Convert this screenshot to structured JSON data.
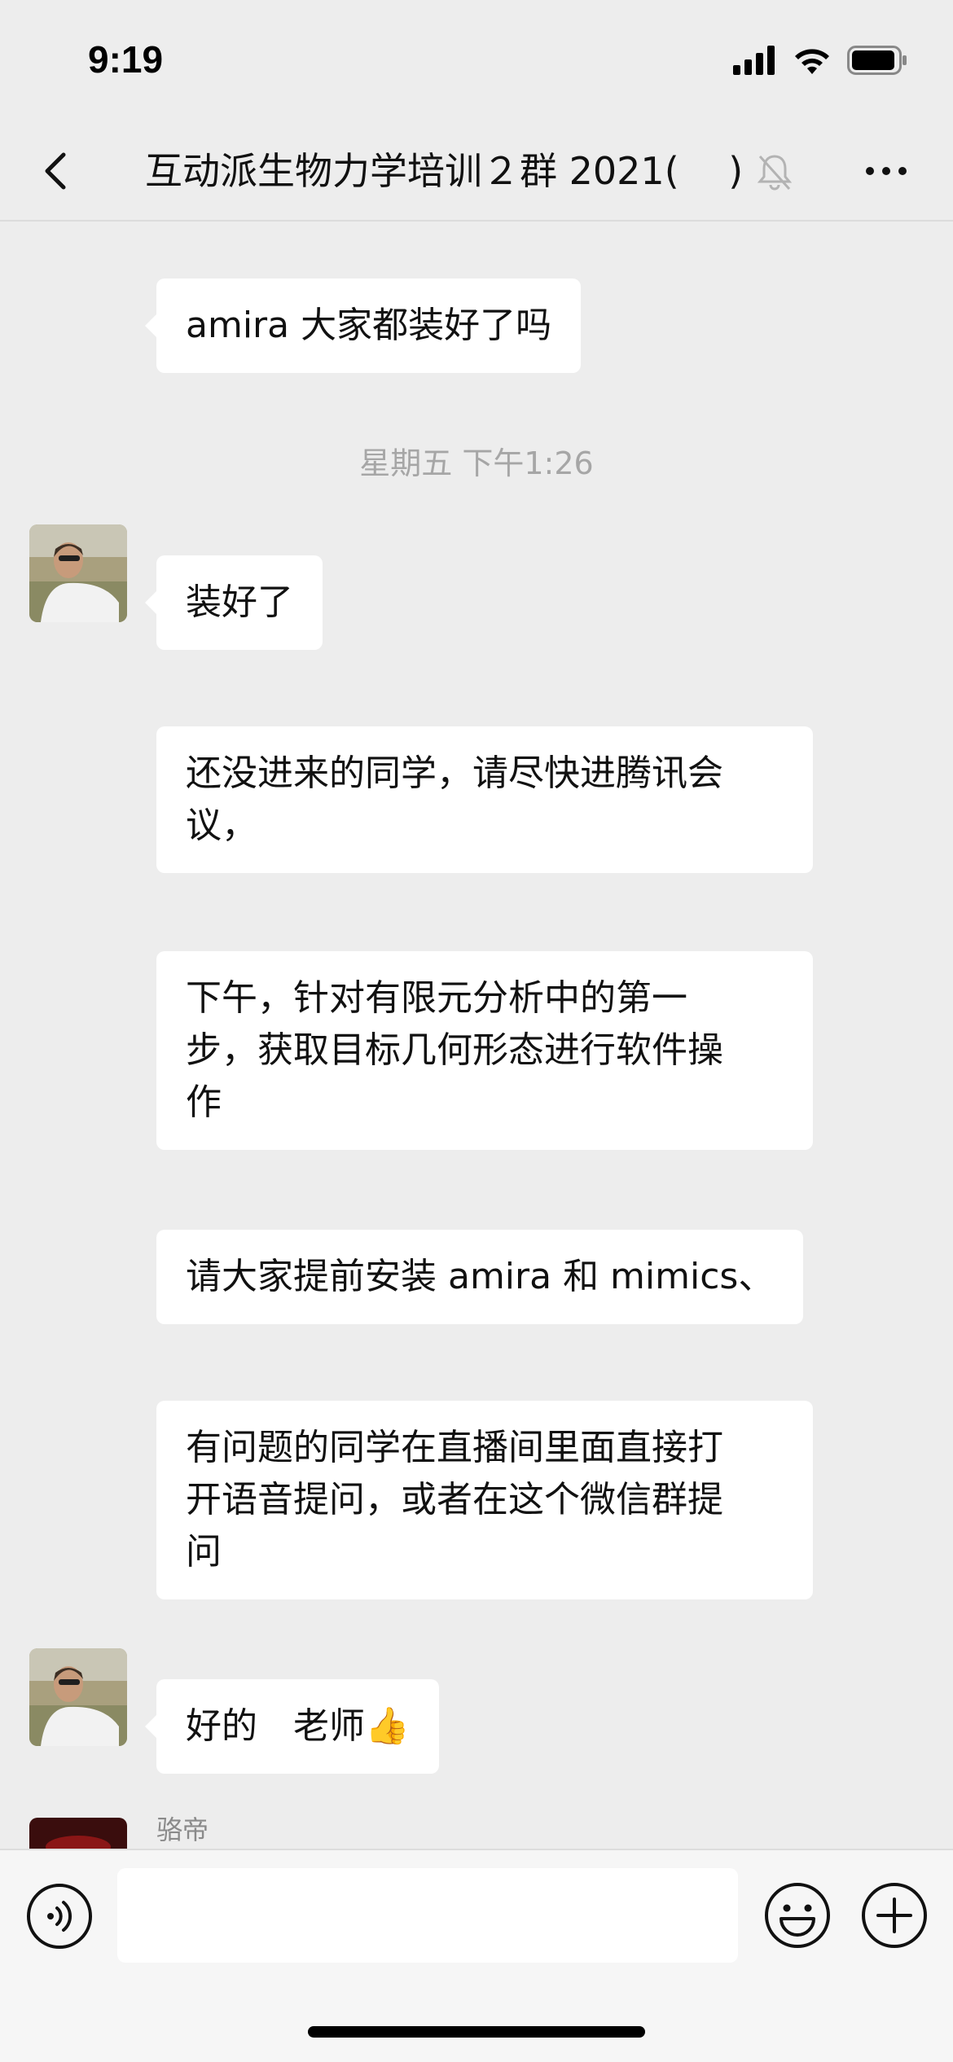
{
  "status_bar": {
    "time": "9:19"
  },
  "nav": {
    "title": "互动派生物力学培训２群 2021(　 )",
    "back_icon": "chevron-left-icon",
    "mute_icon": "bell-slash-icon",
    "more_icon": "more-dots-icon"
  },
  "messages": [
    {
      "type": "text",
      "text": "amira 大家都装好了吗"
    },
    {
      "type": "timestamp",
      "text": "星期五 下午1:26"
    },
    {
      "type": "text",
      "text": "装好了"
    },
    {
      "type": "text",
      "lines": [
        "还没进来的同学，请尽快进腾讯会",
        "议，"
      ]
    },
    {
      "type": "text",
      "lines": [
        "下午，针对有限元分析中的第一",
        "步，获取目标几何形态进行软件操",
        "作"
      ]
    },
    {
      "type": "text",
      "text": "请大家提前安装 amira 和 mimics、"
    },
    {
      "type": "text",
      "lines": [
        "有问题的同学在直播间里面直接打",
        "开语音提问，或者在这个微信群提",
        "问"
      ]
    },
    {
      "type": "text",
      "text": "好的　老师",
      "emoji": "👍"
    },
    {
      "type": "sender",
      "text": "骆帝"
    }
  ],
  "input_bar": {
    "placeholder": "",
    "voice_icon": "voice-icon",
    "emoji_icon": "emoji-icon",
    "plus_icon": "plus-icon"
  },
  "colors": {
    "background": "#ededed",
    "bubble": "#ffffff",
    "timestamp": "#a6a6a6"
  }
}
